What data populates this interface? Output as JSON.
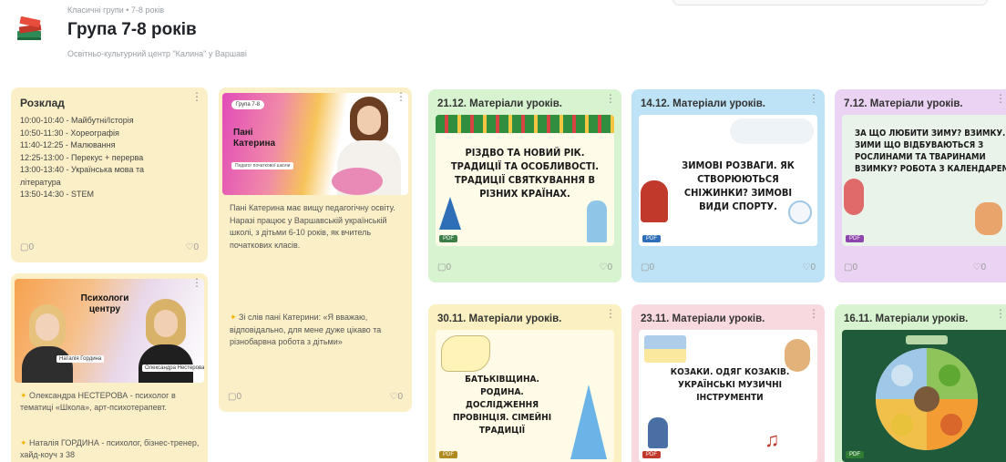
{
  "header": {
    "breadcrumb": "Класичні групи • 7-8 років",
    "title": "Група 7-8 років",
    "subtitle": "Освітньо-культурний центр \"Калина\" у Варшаві"
  },
  "schedule_card": {
    "title": "Розклад",
    "items": [
      "10:00-10:40 - Майбутні/Історія",
      "10:50-11:30 - Хореографія",
      "11:40-12:25 - Малювання",
      "12:25-13:00 - Перекус + перерва",
      "13:00-13:40 - Українська мова та",
      "література",
      "13:50-14:30 - STEM"
    ],
    "comments": "0",
    "likes": "0"
  },
  "teacher_card": {
    "badge": "Група 7-8",
    "name_line1": "Пані",
    "name_line2": "Катерина",
    "tagline": "Педагог початкової школи",
    "bio": "Пані Катерина має вищу педагогічну освіту. Наразі працює у Варшавській українській школі, з дітьми 6-10 років, як вчитель початкових класів.",
    "quote": "Зі слів пані Катерини: «Я вважаю, відповідально, для мене дуже цікаво та різнобарвна робота з дітьми»",
    "comments": "0",
    "likes": "0"
  },
  "psych_card": {
    "banner_title_line1": "Психологи",
    "banner_title_line2": "центру",
    "person1": "Наталія Гордина",
    "person2": "Олександра Нестерова",
    "text1": "Олександра НЕСТЕРОВА - психолог в тематиці «Школа», арт-психотерапевт.",
    "text2": "Наталія ГОРДИНА - психолог, бізнес-тренер, хайд-коуч з 38"
  },
  "lesson_cards": [
    {
      "title": "21.12. Матеріали уроків.",
      "board_text": "Різдво та Новий рік. Традиції та особливості. Традиції святкування в різних країнах.",
      "corner": "PDF",
      "comments": "0",
      "likes": "0",
      "bg": "#d7f3cf"
    },
    {
      "title": "14.12. Матеріали уроків.",
      "board_text": "Зимові розваги. Як створюються сніжинки? Зимові види спорту.",
      "corner": "PDF",
      "comments": "0",
      "likes": "0",
      "bg": "#bfe3f6"
    },
    {
      "title": "7.12. Матеріали уроків.",
      "board_text": "За що любити зиму? Взимку. Зими що відбуваються з рослинами та тваринами взимку? Робота з календарем",
      "corner": "PDF",
      "comments": "0",
      "likes": "0",
      "bg": "#ead3f3"
    },
    {
      "title": "30.11. Матеріали уроків.",
      "board_text": "Батьківщина. Родина. Дослідження Провінція. Сімейні традиції",
      "corner": "PDF",
      "bg": "#fbf0c2"
    },
    {
      "title": "23.11. Матеріали уроків.",
      "board_text": "Козаки. Одяг козаків. Українські музичні інструменти",
      "corner": "PDF",
      "bg": "#f8d9df"
    },
    {
      "title": "16.11. Матеріали уроків.",
      "corner": "PDF",
      "bg": "#d7f3cf"
    }
  ]
}
